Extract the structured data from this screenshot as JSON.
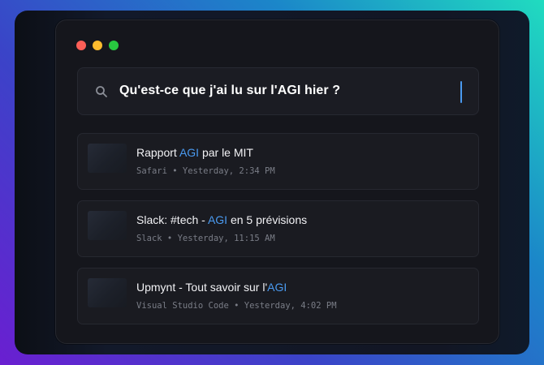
{
  "window": {
    "controls": [
      "close",
      "minimize",
      "zoom"
    ]
  },
  "search": {
    "icon": "search-icon",
    "query": "Qu'est-ce que j'ai lu sur l'AGI hier ?"
  },
  "accent_color": "#4a9af0",
  "results": [
    {
      "title_before": "Rapport ",
      "title_highlight": "AGI",
      "title_after": " par le MIT",
      "meta": "Safari • Yesterday, 2:34 PM"
    },
    {
      "title_before": "Slack: #tech - ",
      "title_highlight": "AGI",
      "title_after": " en 5 prévisions",
      "meta": "Slack • Yesterday, 11:15 AM"
    },
    {
      "title_before": "Upmynt - Tout savoir sur l'",
      "title_highlight": "AGI",
      "title_after": "",
      "meta": "Visual Studio Code • Yesterday, 4:02 PM"
    }
  ]
}
